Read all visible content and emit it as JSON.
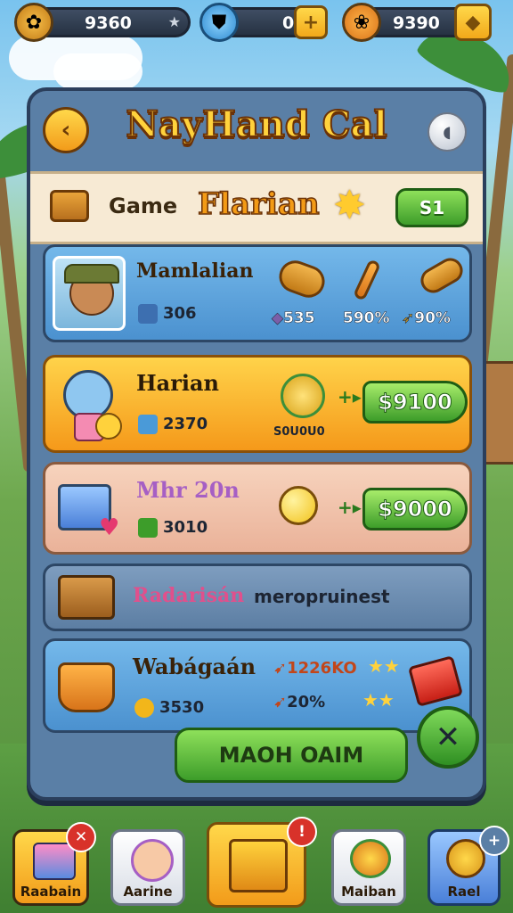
{
  "top_bar": {
    "coins_value": "9360",
    "gems_value": "0",
    "gold_value": "9390"
  },
  "panel": {
    "title": "NayHand Cal",
    "sub_label": "Game",
    "sub_name": "Flarian",
    "sub_button": "S1"
  },
  "cards": [
    {
      "title": "Mamlalian",
      "stat": "306",
      "items": [
        "535",
        "590%",
        "90%"
      ]
    },
    {
      "title": "Harian",
      "stat": "2370",
      "coin_label": "S0U0U0",
      "price": "$9100"
    },
    {
      "title": "Mhr 20n",
      "stat": "3010",
      "price": "$9000"
    },
    {
      "title": "Radarisán",
      "subtitle": "meropruinest"
    },
    {
      "title": "Wabágaán",
      "stat": "3530",
      "value1": "1226KO",
      "value2": "20%"
    }
  ],
  "main_button": "MAOH OAIM",
  "bottom_nav": [
    "Raabain",
    "Aarine",
    "Maiban",
    "Rael"
  ],
  "colors": {
    "accent_gold": "#ffd23c",
    "accent_green": "#3d9d2a",
    "panel_blue": "#5a7fa6"
  }
}
